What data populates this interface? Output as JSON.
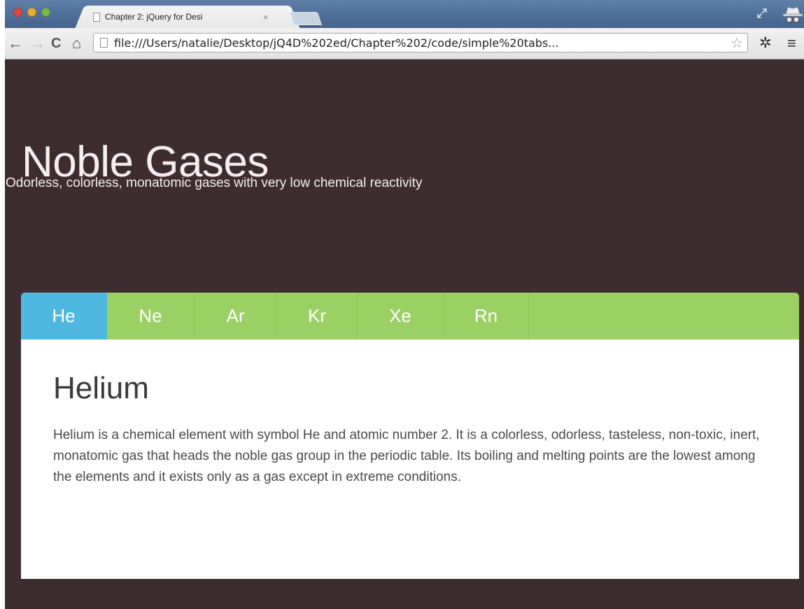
{
  "browser": {
    "tab_title": "Chapter 2: jQuery for Desi",
    "tab_close": "×",
    "url": "file:///Users/natalie/Desktop/jQ4D%202ed/Chapter%202/code/simple%20tabs...",
    "icons": {
      "back": "back-arrow-icon",
      "forward": "forward-arrow-icon",
      "reload": "reload-icon",
      "home": "home-icon",
      "star": "bookmark-star-icon",
      "settings": "wrench-icon",
      "menu": "hamburger-menu-icon",
      "fullscreen": "fullscreen-icon",
      "incognito": "incognito-icon"
    }
  },
  "page": {
    "title": "Noble Gases",
    "subtitle": "Odorless, colorless, monatomic gases with very low chemical reactivity"
  },
  "tabs": [
    {
      "label": "He",
      "active": true
    },
    {
      "label": "Ne",
      "active": false
    },
    {
      "label": "Ar",
      "active": false
    },
    {
      "label": "Kr",
      "active": false
    },
    {
      "label": "Xe",
      "active": false
    },
    {
      "label": "Rn",
      "active": false
    }
  ],
  "panel": {
    "heading": "Helium",
    "text": "Helium is a chemical element with symbol He and atomic number 2. It is a colorless, odorless, tasteless, non-toxic, inert, monatomic gas that heads the noble gas group in the periodic table. Its boiling and melting points are the lowest among the elements and it exists only as a gas except in extreme conditions."
  },
  "colors": {
    "page_background": "#3d2d31",
    "tab_bar": "#9bd164",
    "active_tab": "#4fb8e0",
    "panel_background": "#ffffff"
  }
}
